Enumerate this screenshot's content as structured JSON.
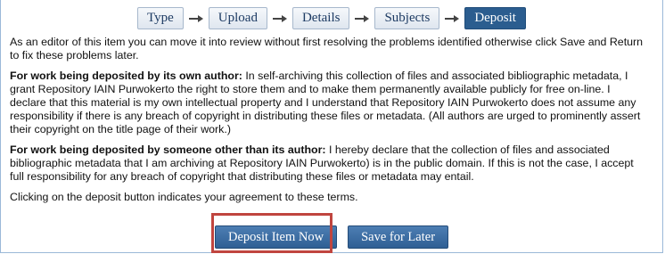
{
  "steps": [
    {
      "label": "Type"
    },
    {
      "label": "Upload"
    },
    {
      "label": "Details"
    },
    {
      "label": "Subjects"
    },
    {
      "label": "Deposit",
      "active": true
    }
  ],
  "intro": "As an editor of this item you can move it into review without first resolving the problems identified otherwise click Save and Return to fix these problems later.",
  "own_author": {
    "heading": "For work being deposited by its own author:",
    "text": "In self-archiving this collection of files and associated bibliographic metadata, I grant Repository IAIN Purwokerto the right to store them and to make them permanently available publicly for free on-line. I declare that this material is my own intellectual property and I understand that Repository IAIN Purwokerto does not assume any responsibility if there is any breach of copyright in distributing these files or metadata. (All authors are urged to prominently assert their copyright on the title page of their work.)"
  },
  "other_author": {
    "heading": "For work being deposited by someone other than its author:",
    "text": "I hereby declare that the collection of files and associated bibliographic metadata that I am archiving at Repository IAIN Purwokerto) is in the public domain. If this is not the case, I accept full responsibility for any breach of copyright that distributing these files or metadata may entail."
  },
  "agreement": "Clicking on the deposit button indicates your agreement to these terms.",
  "buttons": {
    "deposit": "Deposit Item Now",
    "save_later": "Save for Later"
  },
  "colors": {
    "active_step": "#2b5d8f",
    "button": "#3a6ca1",
    "highlight": "#c0453f"
  }
}
